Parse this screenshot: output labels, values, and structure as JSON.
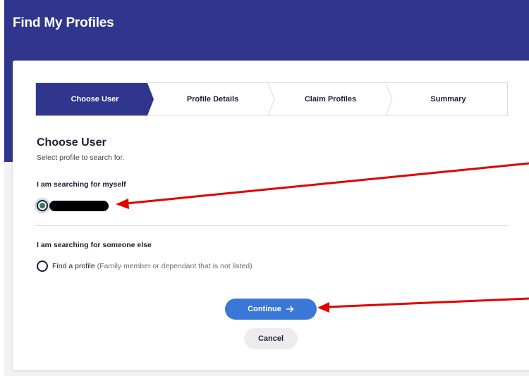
{
  "page": {
    "title": "Find My Profiles"
  },
  "stepper": {
    "steps": [
      {
        "label": "Choose User",
        "active": true
      },
      {
        "label": "Profile Details",
        "active": false
      },
      {
        "label": "Claim Profiles",
        "active": false
      },
      {
        "label": "Summary",
        "active": false
      }
    ]
  },
  "section": {
    "title": "Choose User",
    "subtitle": "Select profile to search for."
  },
  "myself_group": {
    "label": "I am searching for myself",
    "selected": true
  },
  "someone_group": {
    "label": "I am searching for someone else",
    "option_label": "Find a profile",
    "option_hint": "(Family member or dependant that is not listed)",
    "selected": false
  },
  "actions": {
    "continue_label": "Continue",
    "continue_icon": "arrow-right-icon",
    "cancel_label": "Cancel"
  },
  "colors": {
    "brand": "#30358e",
    "primary_button": "#3a78d8",
    "selected_radio": "#2e7d55",
    "annotation_arrow": "#e00000"
  }
}
